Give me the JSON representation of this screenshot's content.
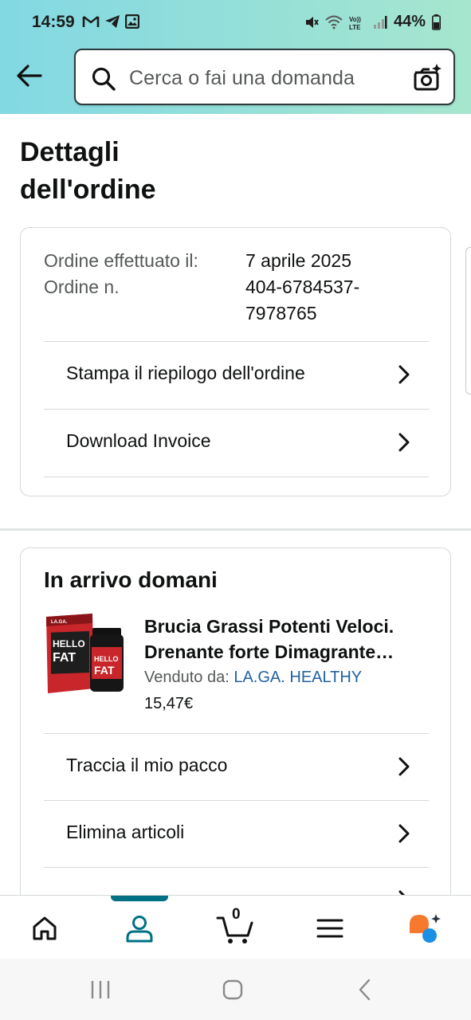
{
  "status_bar": {
    "time": "14:59",
    "battery": "44%",
    "lte_label": "Vo)) LTE"
  },
  "search": {
    "placeholder": "Cerca o fai una domanda"
  },
  "page": {
    "title_line1": "Dettagli",
    "title_line2": "dell'ordine"
  },
  "order_info": {
    "date_label": "Ordine effettuato il:",
    "date_value": "7 aprile 2025",
    "number_label": "Ordine n.",
    "number_value_line1": "404-6784537-",
    "number_value_line2": "7978765"
  },
  "order_actions": [
    {
      "label": "Stampa il riepilogo dell'ordine"
    },
    {
      "label": "Download Invoice"
    }
  ],
  "shipment": {
    "heading": "In arrivo domani",
    "product_title_line1": "Brucia Grassi Potenti Veloci.",
    "product_title_line2": "Drenante forte Dimagrante…",
    "seller_prefix": "Venduto da:",
    "seller_name": "LA.GA. HEALTHY",
    "price": "15,47€",
    "product_image_text": {
      "brand": "LA.GA.",
      "line1": "HELLO",
      "line2": "FAT"
    }
  },
  "shipment_actions": [
    {
      "label": "Traccia il mio pacco"
    },
    {
      "label": "Elimina articoli"
    }
  ],
  "bottom_nav": {
    "cart_count": "0",
    "active": "account"
  },
  "colors": {
    "header_gradient_start": "#82d8e3",
    "header_gradient_end": "#a6e6ce",
    "accent_teal": "#007185",
    "link_blue": "#2162a1",
    "rufus_orange": "#f7792e",
    "rufus_blue": "#1a8fe3"
  }
}
